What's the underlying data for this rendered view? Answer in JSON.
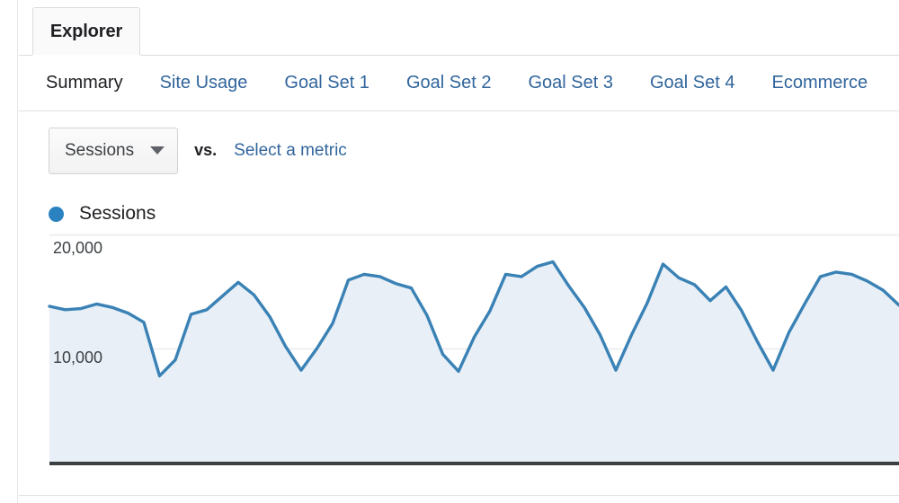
{
  "report_tab": {
    "label": "Explorer"
  },
  "subnav": {
    "items": [
      {
        "label": "Summary",
        "active": true
      },
      {
        "label": "Site Usage",
        "active": false
      },
      {
        "label": "Goal Set 1",
        "active": false
      },
      {
        "label": "Goal Set 2",
        "active": false
      },
      {
        "label": "Goal Set 3",
        "active": false
      },
      {
        "label": "Goal Set 4",
        "active": false
      },
      {
        "label": "Ecommerce",
        "active": false
      }
    ]
  },
  "metric_bar": {
    "primary_metric": "Sessions",
    "caret_icon": "chevron-down-icon",
    "vs_label": "vs.",
    "secondary_metric_link": "Select a metric"
  },
  "legend": {
    "series_label": "Sessions",
    "series_color": "#2b82c0"
  },
  "chart_data": {
    "type": "area",
    "title": "Sessions",
    "xlabel": "",
    "ylabel": "",
    "ylim": [
      0,
      22000
    ],
    "yticks": [
      10000,
      20000
    ],
    "ytick_labels": [
      "10,000",
      "20,000"
    ],
    "grid": true,
    "legend_position": "top-left",
    "line_color": "#3a82b5",
    "fill_color": "#e8eff7",
    "series": [
      {
        "name": "Sessions",
        "values": [
          13700,
          13400,
          13500,
          13900,
          13600,
          13100,
          12300,
          7600,
          9000,
          13000,
          13400,
          14600,
          15800,
          14700,
          12800,
          10200,
          8100,
          10000,
          12200,
          16000,
          16500,
          16300,
          15700,
          15300,
          12900,
          9500,
          8000,
          11000,
          13300,
          16500,
          16300,
          17200,
          17600,
          15500,
          13600,
          11200,
          8100,
          11200,
          14000,
          17400,
          16200,
          15600,
          14200,
          15400,
          13300,
          10600,
          8100,
          11400,
          13900,
          16300,
          16700,
          16500,
          15900,
          15100,
          13800
        ]
      }
    ]
  },
  "bottom_divider": true
}
